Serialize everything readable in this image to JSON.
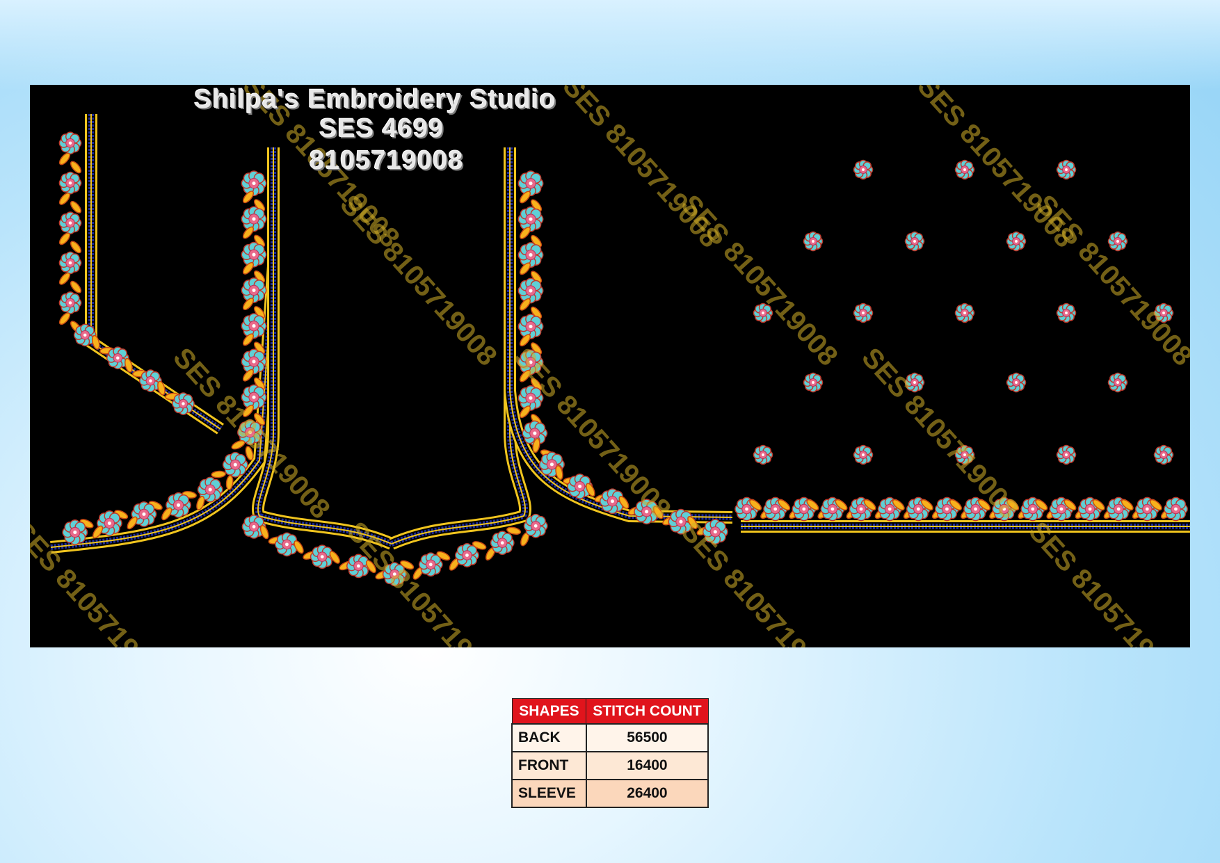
{
  "header": {
    "studio_name": "Shilpa's Embroidery Studio",
    "design_code": "SES 4699",
    "phone": "8105719008"
  },
  "watermark": {
    "text": "SES 8105719008",
    "color": "#d2af28"
  },
  "design_colors": {
    "background": "#000000",
    "gold_thread": "#f0c41e",
    "blue_thread": "#1b2a9c",
    "flower_petal": "#5fd0d6",
    "flower_center": "#e86a8a",
    "leaf": "#f7b11c"
  },
  "stitch_table": {
    "headers": [
      "SHAPES",
      "STITCH COUNT"
    ],
    "rows": [
      {
        "shape": "BACK",
        "count": "56500"
      },
      {
        "shape": "FRONT",
        "count": "16400"
      },
      {
        "shape": "SLEEVE",
        "count": "26400"
      }
    ],
    "header_color": "#e0141c"
  }
}
